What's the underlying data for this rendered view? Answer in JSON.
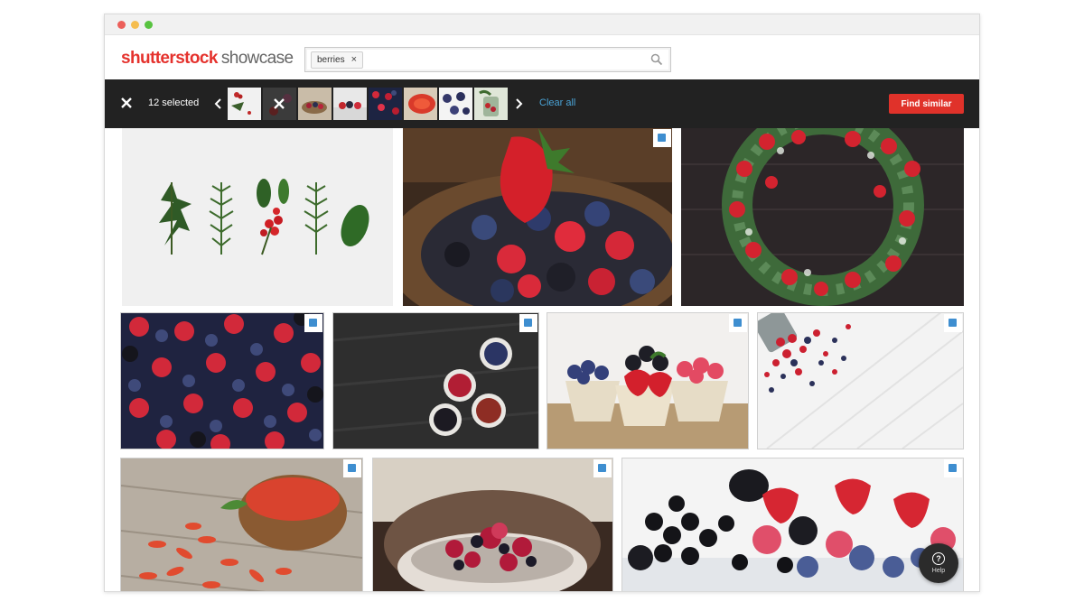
{
  "window": {
    "controls": [
      "close-dot",
      "minimize-dot",
      "maximize-dot"
    ],
    "control_colors": [
      "#ec5f5a",
      "#f5bd4f",
      "#58c340"
    ]
  },
  "logo": {
    "brand": "shutterstock",
    "product": "showcase",
    "brand_color": "#e5322d"
  },
  "search": {
    "chip_label": "berries",
    "chip_remove": "×",
    "icon": "search-icon"
  },
  "selection": {
    "count_label": "12 selected",
    "clear_all_label": "Clear all",
    "find_similar_label": "Find similar",
    "accent_color": "#e0322a",
    "thumbnails": [
      "holly-sprigs",
      "red-berries-on-white",
      "berries-in-bowl",
      "berry-dessert",
      "mixed-berries",
      "goji-berries",
      "blueberries",
      "berry-jar"
    ]
  },
  "results": [
    {
      "subject": "Holly and fir sprigs on white",
      "selected": false
    },
    {
      "subject": "Strawberries, blueberries and raspberries in basket",
      "selected": true
    },
    {
      "subject": "Christmas wreath with red baubles",
      "selected": false
    },
    {
      "subject": "Raspberries, blueberries and blackberries flat lay",
      "selected": true
    },
    {
      "subject": "Bowls of dried berries on slate",
      "selected": true
    },
    {
      "subject": "Berries in small baskets on burlap",
      "selected": true
    },
    {
      "subject": "Berries spilling from bucket on white planks",
      "selected": true
    },
    {
      "subject": "Goji berries in wooden bowl",
      "selected": true
    },
    {
      "subject": "Mixed berries in bowl",
      "selected": true
    },
    {
      "subject": "Blackcurrants, strawberries and blueberries",
      "selected": true
    }
  ],
  "help": {
    "label": "Help",
    "glyph": "?"
  }
}
